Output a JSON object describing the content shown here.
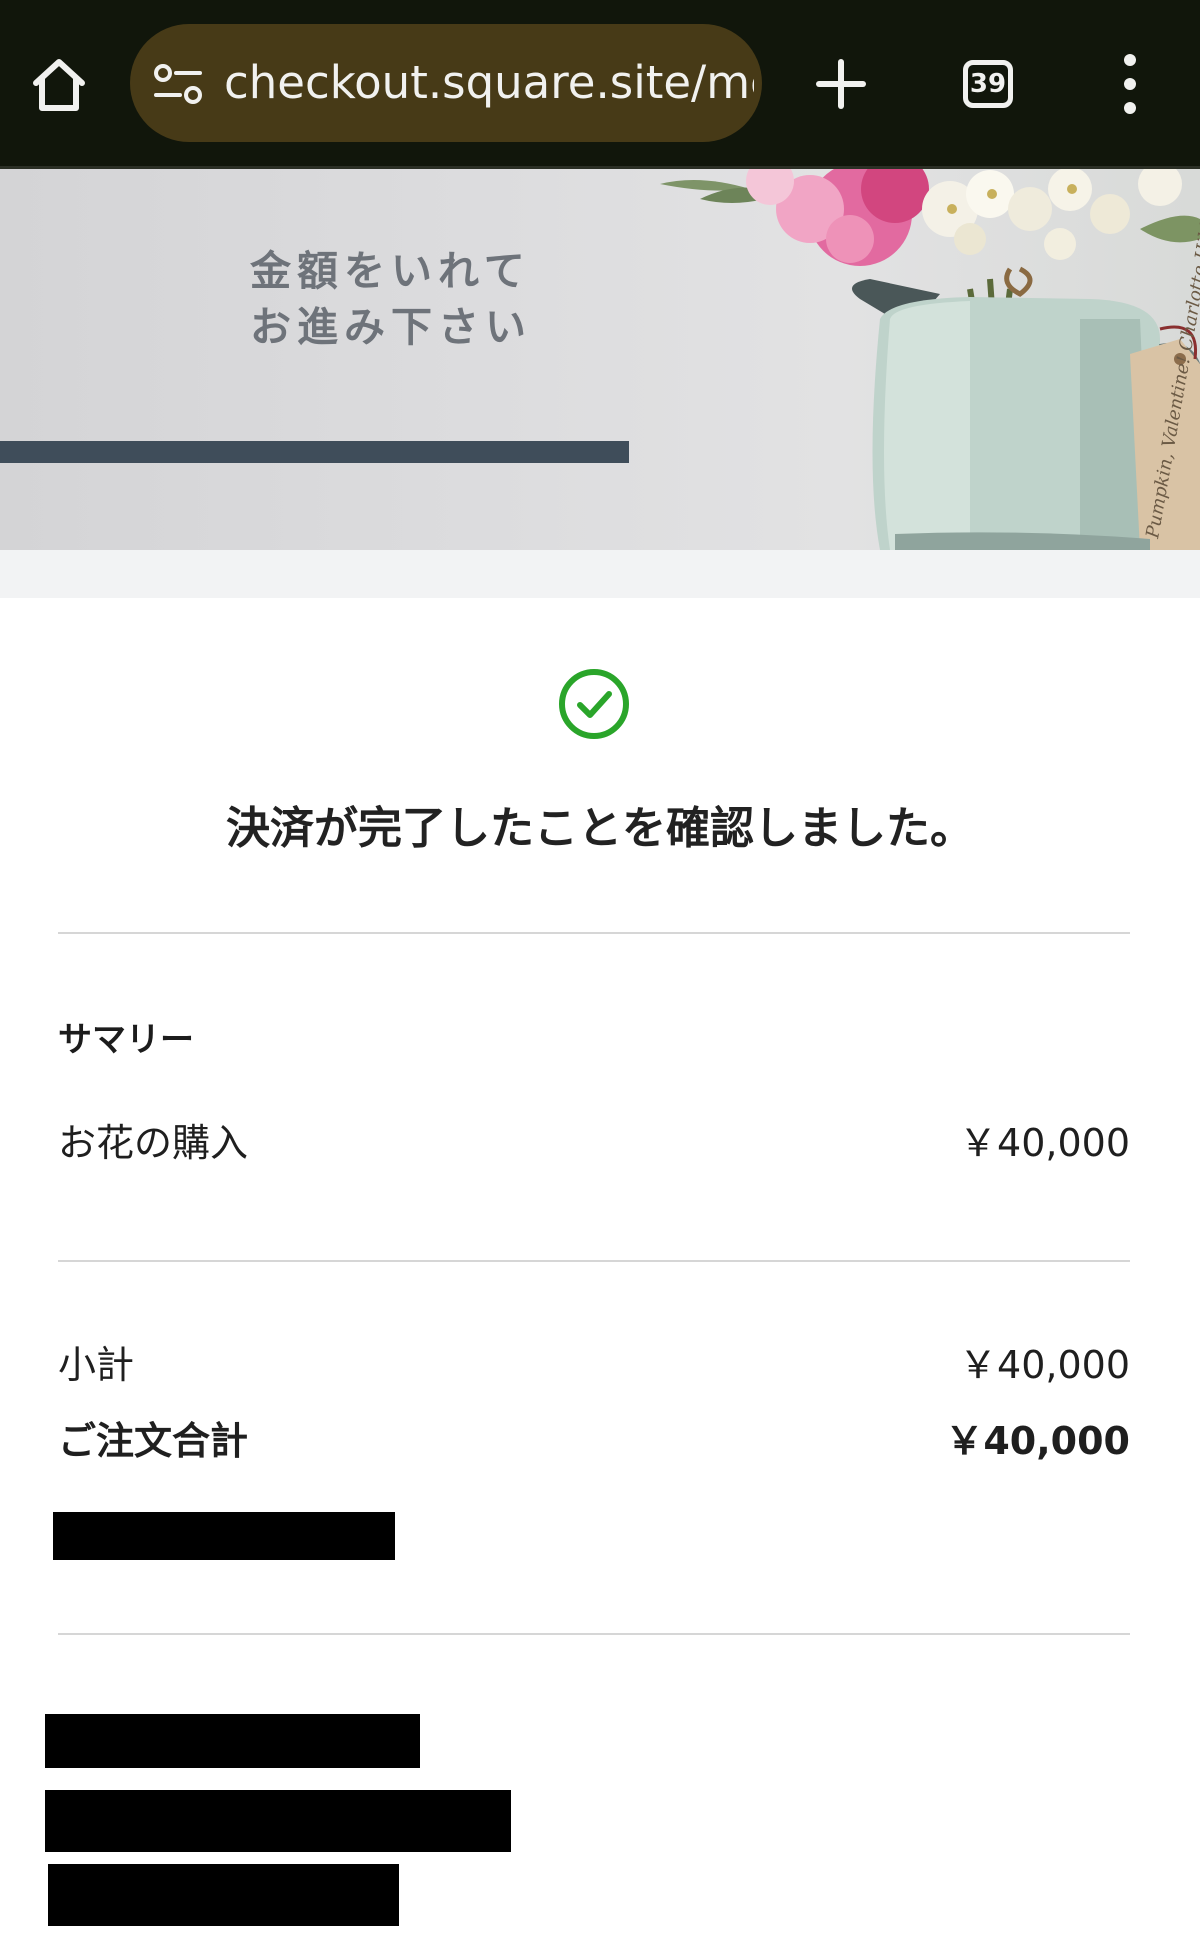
{
  "browser": {
    "url": "checkout.square.site/me",
    "tab_count": "39"
  },
  "banner": {
    "line1": "金額をいれて",
    "line2": "お進み下さい",
    "tag_text": "Pumpkin, Valentine! Charlotte Hilda"
  },
  "confirmation": {
    "message": "決済が完了したことを確認しました。",
    "accent_color": "#2aa52a"
  },
  "summary": {
    "heading": "サマリー",
    "items": [
      {
        "name": "お花の購入",
        "price": "￥40,000"
      }
    ],
    "subtotal_label": "小計",
    "subtotal_value": "￥40,000",
    "total_label": "ご注文合計",
    "total_value": "￥40,000"
  }
}
